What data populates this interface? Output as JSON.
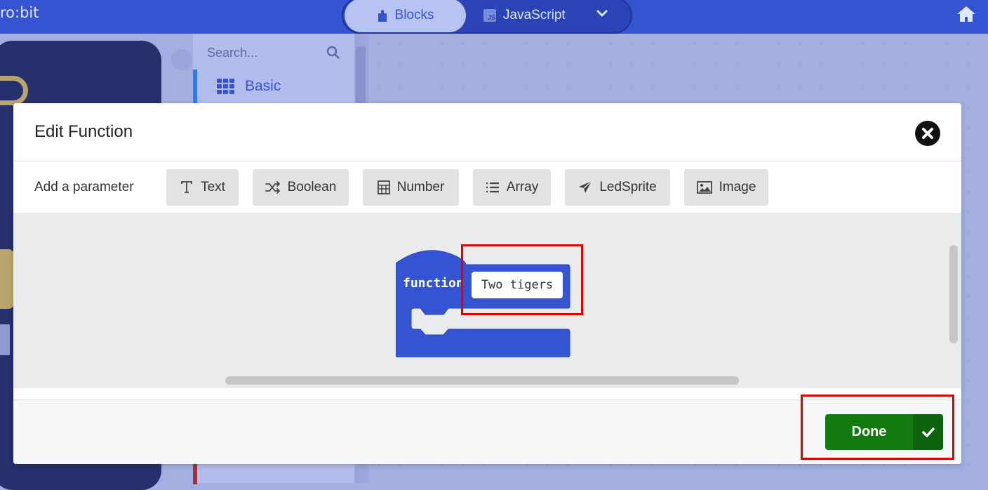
{
  "app": {
    "title": "ro:bit"
  },
  "mode_switch": {
    "blocks_label": "Blocks",
    "javascript_label": "JavaScript",
    "js_badge": "JS"
  },
  "toolbox": {
    "search_placeholder": "Search...",
    "categories": [
      {
        "label": "Basic",
        "color": "#2f7bf0"
      }
    ]
  },
  "dialog": {
    "title": "Edit Function",
    "add_parameter_label": "Add a parameter",
    "parameter_types": [
      {
        "label": "Text",
        "icon": "text-type-icon"
      },
      {
        "label": "Boolean",
        "icon": "shuffle-icon"
      },
      {
        "label": "Number",
        "icon": "calculator-icon"
      },
      {
        "label": "Array",
        "icon": "list-icon"
      },
      {
        "label": "LedSprite",
        "icon": "paper-plane-icon"
      },
      {
        "label": "Image",
        "icon": "image-icon"
      }
    ],
    "function_block": {
      "keyword": "function",
      "name": "Two tigers",
      "color": "#3454d1"
    },
    "done_label": "Done"
  },
  "colors": {
    "accent": "#3454d1",
    "done_green": "#127a10",
    "highlight": "#e00000"
  }
}
